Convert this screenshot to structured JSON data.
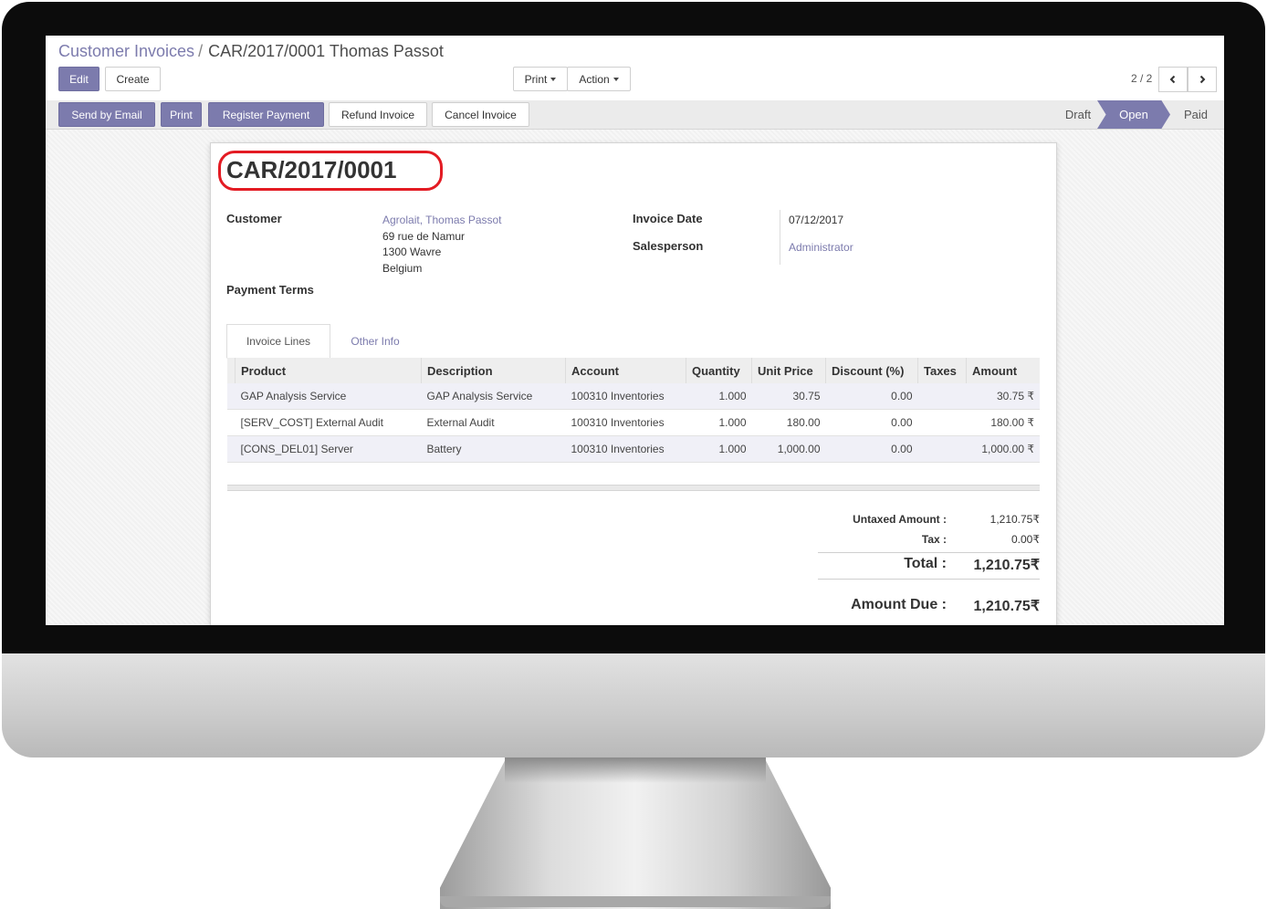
{
  "breadcrumb": {
    "parent": "Customer Invoices",
    "separator": "/",
    "current": "CAR/2017/0001 Thomas Passot"
  },
  "toolbar": {
    "edit": "Edit",
    "create": "Create",
    "print": "Print",
    "action": "Action"
  },
  "pager": {
    "value": "2 / 2"
  },
  "header_buttons": {
    "send_email": "Send by Email",
    "print": "Print",
    "register_payment": "Register Payment",
    "refund": "Refund Invoice",
    "cancel": "Cancel Invoice"
  },
  "status": {
    "draft": "Draft",
    "open": "Open",
    "paid": "Paid",
    "current": "Open"
  },
  "invoice": {
    "number": "CAR/2017/0001",
    "customer_label": "Customer",
    "customer_name": "Agrolait, Thomas Passot",
    "address_line1": "69 rue de Namur",
    "address_line2": "1300 Wavre",
    "address_line3": "Belgium",
    "payment_terms_label": "Payment Terms",
    "invoice_date_label": "Invoice Date",
    "invoice_date": "07/12/2017",
    "salesperson_label": "Salesperson",
    "salesperson": "Administrator"
  },
  "tabs": {
    "lines": "Invoice Lines",
    "other": "Other Info"
  },
  "table": {
    "columns": [
      "Product",
      "Description",
      "Account",
      "Quantity",
      "Unit Price",
      "Discount (%)",
      "Taxes",
      "Amount"
    ],
    "rows": [
      {
        "product": "GAP Analysis Service",
        "description": "GAP Analysis Service",
        "account": "100310 Inventories",
        "quantity": "1.000",
        "unit_price": "30.75",
        "discount": "0.00",
        "taxes": "",
        "amount": "30.75 ₹"
      },
      {
        "product": "[SERV_COST] External Audit",
        "description": "External Audit",
        "account": "100310 Inventories",
        "quantity": "1.000",
        "unit_price": "180.00",
        "discount": "0.00",
        "taxes": "",
        "amount": "180.00 ₹"
      },
      {
        "product": "[CONS_DEL01] Server",
        "description": "Battery",
        "account": "100310 Inventories",
        "quantity": "1.000",
        "unit_price": "1,000.00",
        "discount": "0.00",
        "taxes": "",
        "amount": "1,000.00 ₹"
      }
    ]
  },
  "totals": {
    "untaxed_label": "Untaxed Amount :",
    "untaxed": "1,210.75₹",
    "tax_label": "Tax :",
    "tax": "0.00₹",
    "total_label": "Total :",
    "total": "1,210.75₹",
    "due_label": "Amount Due :",
    "due": "1,210.75₹"
  },
  "colors": {
    "primary": "#7c7bad",
    "highlight_ring": "#e31b23"
  }
}
